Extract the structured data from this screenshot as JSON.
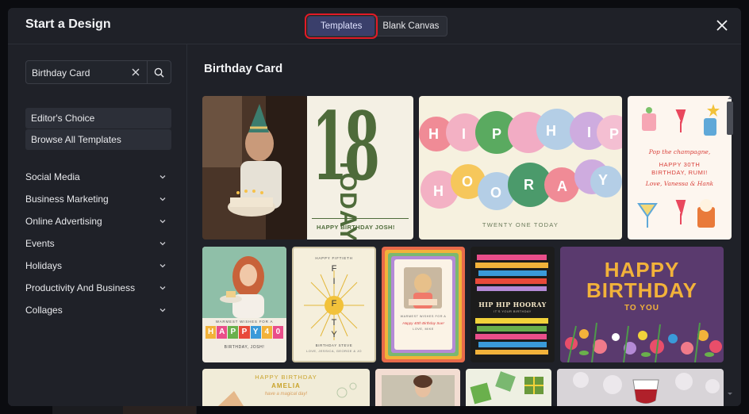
{
  "header": {
    "title": "Start a Design",
    "tabs": [
      {
        "label": "Templates",
        "active": true
      },
      {
        "label": "Blank Canvas",
        "active": false
      }
    ]
  },
  "sidebar": {
    "search_value": "Birthday Card",
    "pills": [
      "Editor's Choice",
      "Browse All Templates"
    ],
    "categories": [
      "Social Media",
      "Business Marketing",
      "Online Advertising",
      "Events",
      "Holidays",
      "Productivity And Business",
      "Collages"
    ]
  },
  "main": {
    "title": "Birthday Card",
    "cards": {
      "c2_big": "18",
      "c2_side": "TODAY",
      "c2_footer": "HAPPY BIRTHDAY JOSH!",
      "c3_letters": [
        "H",
        "I",
        "P",
        "H",
        "I",
        "P",
        "H",
        "O",
        "O",
        "R",
        "A",
        "Y"
      ],
      "c3_footer": "TWENTY ONE TODAY",
      "c4_lines": [
        "Pop the champagne,",
        "HAPPY 30TH",
        "BIRTHDAY, RUMI!",
        "Love, Vanessa & Hank"
      ],
      "c5_top": "WARMEST WISHES FOR A",
      "c5_letters": [
        "H",
        "A",
        "P",
        "P",
        "Y",
        "4",
        "0"
      ],
      "c5_bottom": "BIRTHDAY, JOSH!",
      "c6_top": "HAPPY FIFTIETH",
      "c6_word": [
        "F",
        "I",
        "F",
        "T",
        "Y"
      ],
      "c6_bottom1": "BIRTHDAY STEVE",
      "c6_bottom2": "LOVE, JESSICA, GEORGE & JO",
      "c7_text1": "WARMEST WISHES FOR A",
      "c7_text2": "Happy 40th Birthday Sue!",
      "c7_text3": "LOVE, MIKE",
      "c8_title": "HIP HIP HOORAY",
      "c8_sub": "IT'S YOUR BIRTHDAY",
      "c9_line1": "HAPPY",
      "c9_line2": "BIRTHDAY",
      "c9_line3": "TO YOU",
      "c10_line1": "HAPPY BIRTHDAY",
      "c10_line2": "AMELIA",
      "c10_line3": "have a magical day!"
    }
  },
  "colors": {
    "accent": "#3a3f6b",
    "highlight": "#e21b26",
    "green": "#4e6b3a"
  }
}
